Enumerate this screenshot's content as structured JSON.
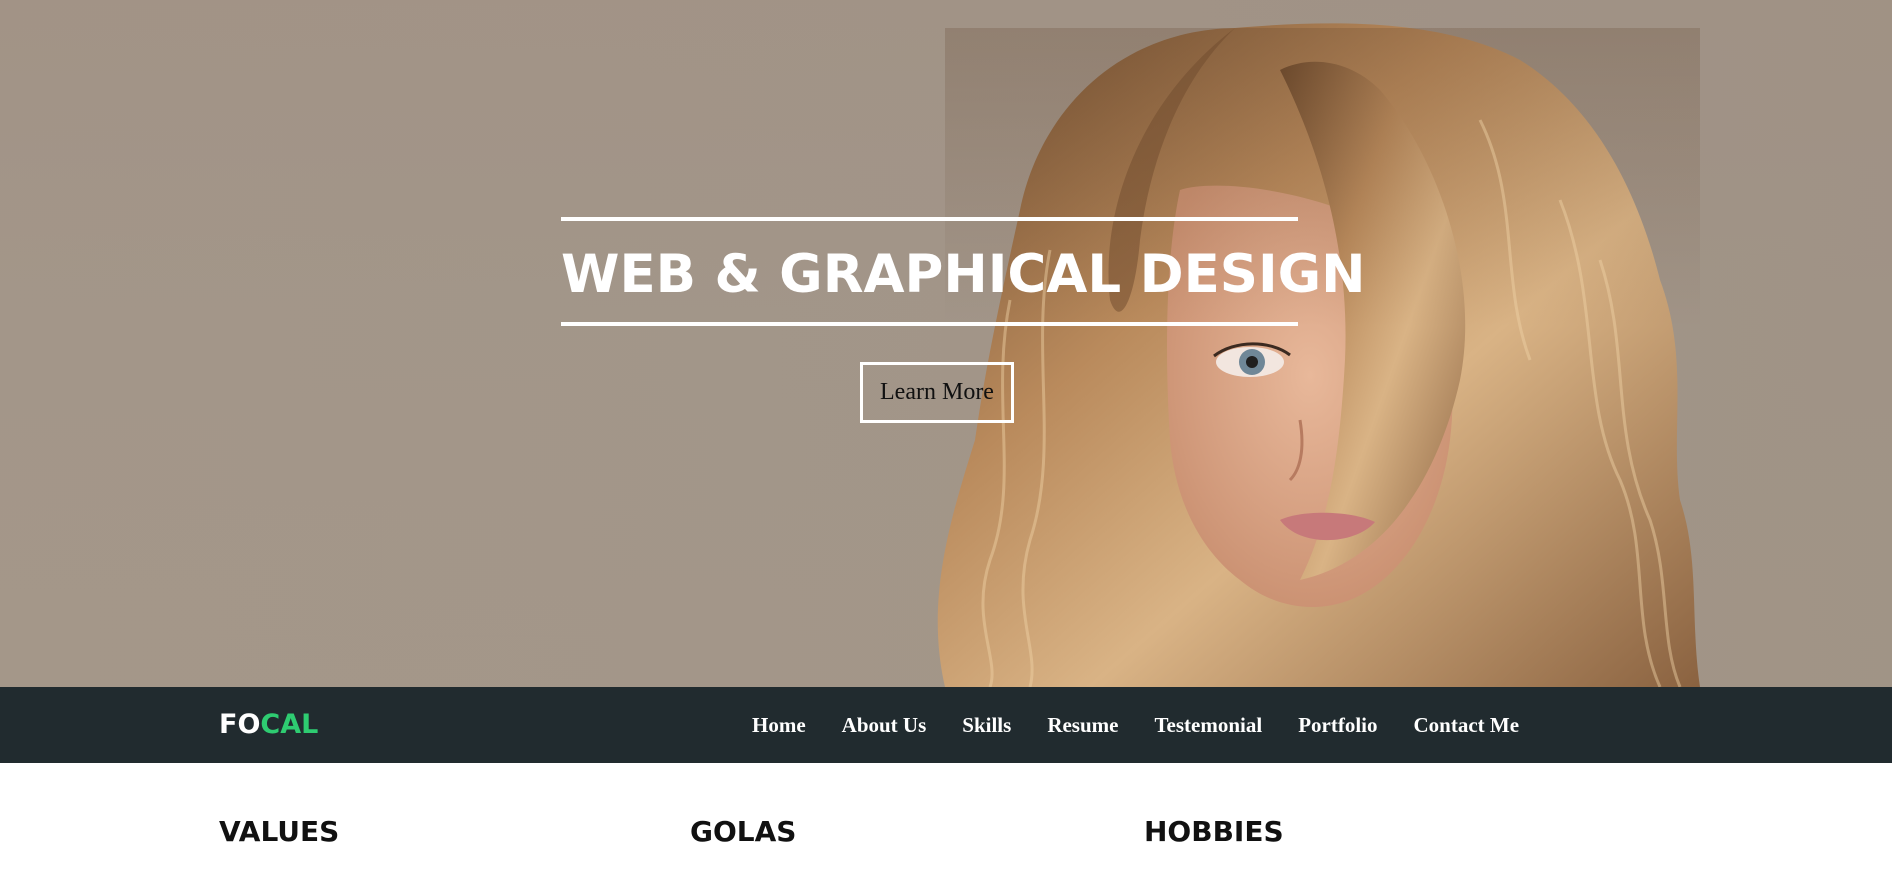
{
  "hero": {
    "title": "WEB & GRAPHICAL DESIGN",
    "button_label": "Learn More",
    "background_color": "#a39689"
  },
  "navbar": {
    "logo_part1": "FO",
    "logo_part2": "CAL",
    "logo_accent_color": "#2ecc71",
    "background_color": "#212b2f",
    "items": [
      {
        "label": "Home"
      },
      {
        "label": "About Us"
      },
      {
        "label": "Skills"
      },
      {
        "label": "Resume"
      },
      {
        "label": "Testemonial"
      },
      {
        "label": "Portfolio"
      },
      {
        "label": "Contact Me"
      }
    ]
  },
  "sections": {
    "values_heading": "VALUES",
    "goals_heading": "GOLAS",
    "hobbies_heading": "HOBBIES"
  }
}
